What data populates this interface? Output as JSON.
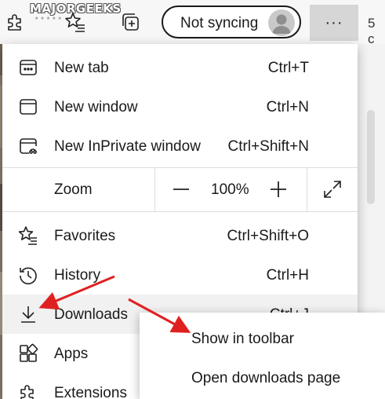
{
  "toolbar": {
    "watermark": "MAJORGEEKS",
    "watermark_stars": "★★★★★",
    "sync_label": "Not syncing",
    "more_label": "···",
    "tab_peek": "5 c"
  },
  "menu": {
    "items_top": [
      {
        "label": "New tab",
        "shortcut": "Ctrl+T",
        "icon": "new-tab-icon"
      },
      {
        "label": "New window",
        "shortcut": "Ctrl+N",
        "icon": "new-window-icon"
      },
      {
        "label": "New InPrivate window",
        "shortcut": "Ctrl+Shift+N",
        "icon": "inprivate-icon"
      }
    ],
    "zoom": {
      "label": "Zoom",
      "minus": "—",
      "value": "100%",
      "plus": "+"
    },
    "items_bottom": [
      {
        "label": "Favorites",
        "shortcut": "Ctrl+Shift+O",
        "icon": "favorites-icon"
      },
      {
        "label": "History",
        "shortcut": "Ctrl+H",
        "icon": "history-icon"
      },
      {
        "label": "Downloads",
        "shortcut": "Ctrl+J",
        "icon": "downloads-icon"
      },
      {
        "label": "Apps",
        "shortcut": "",
        "icon": "apps-icon"
      },
      {
        "label": "Extensions",
        "shortcut": "",
        "icon": "extensions-icon"
      }
    ]
  },
  "submenu": {
    "items": [
      {
        "label": "Show in toolbar"
      },
      {
        "label": "Open downloads page"
      }
    ]
  },
  "colors": {
    "arrow": "#e02020",
    "hover": "#f1f1f1",
    "toolbar": "#f7f7f7"
  }
}
